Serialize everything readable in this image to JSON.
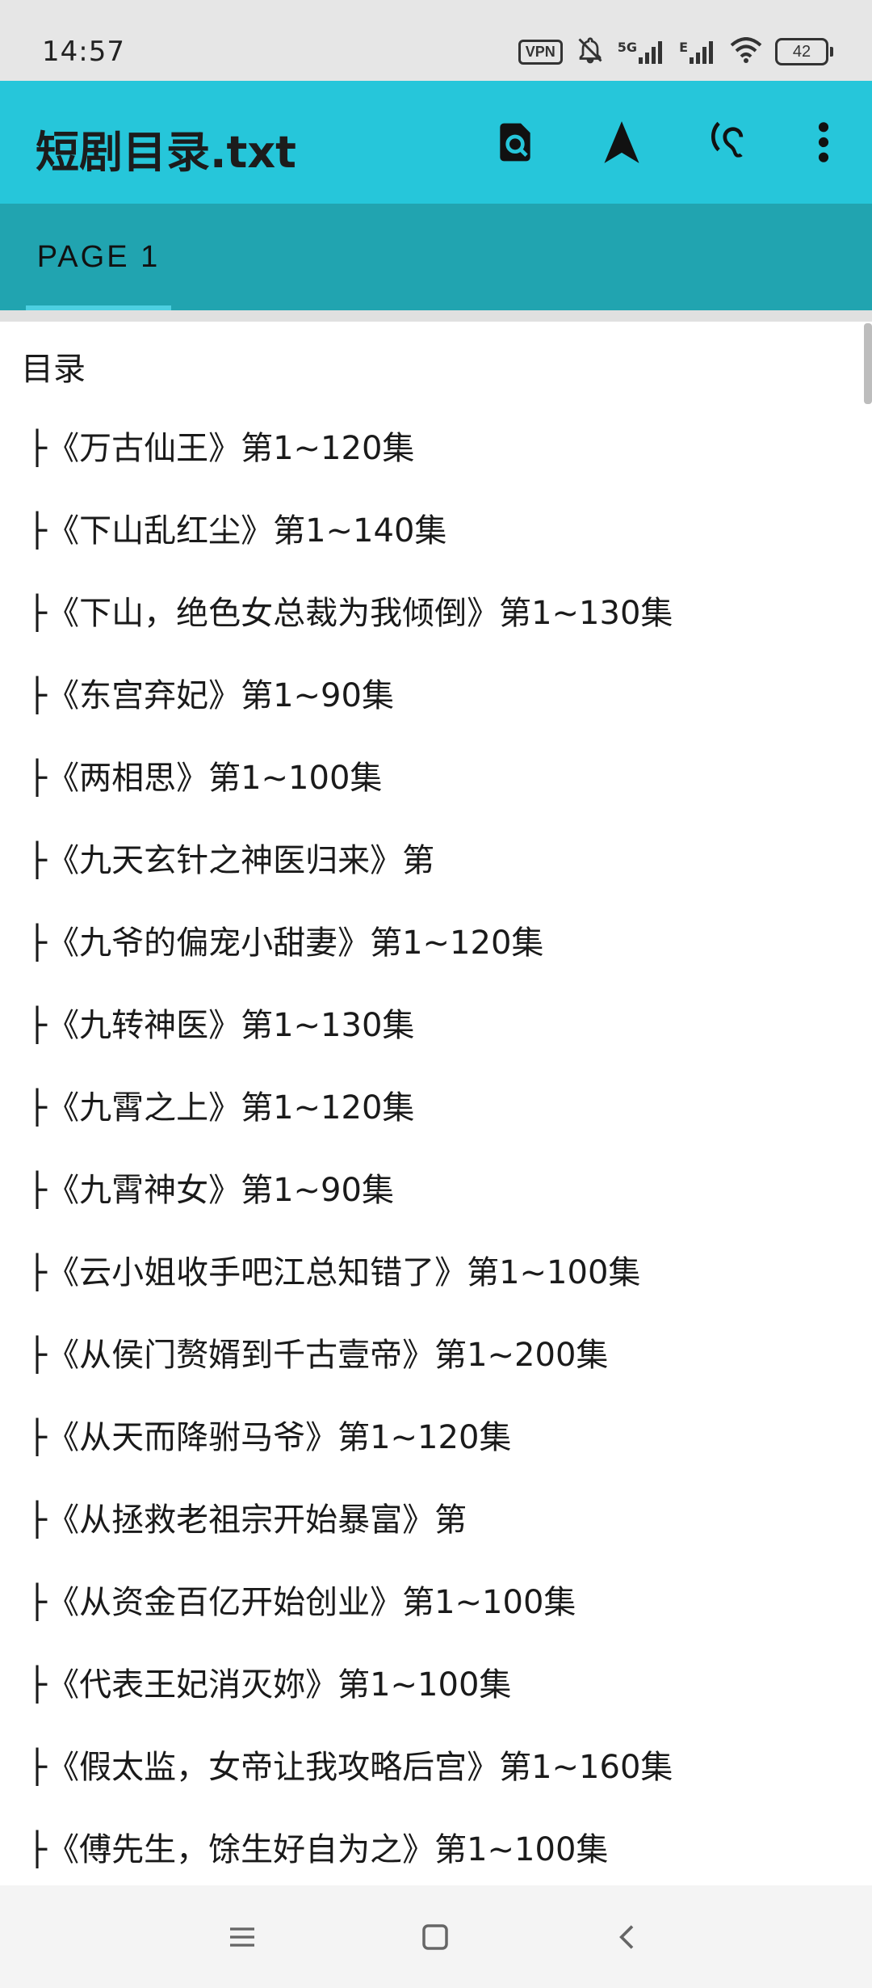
{
  "status_bar": {
    "time": "14:57",
    "vpn_label": "VPN",
    "network_5g": "5G",
    "network_e": "E",
    "battery_level": "42",
    "icons": [
      "vpn-icon",
      "bell-off-icon",
      "signal-5g-icon",
      "signal-e-icon",
      "wifi-icon",
      "battery-icon"
    ]
  },
  "app_bar": {
    "title": "短剧目录.txt",
    "background_color": "#26c6da",
    "icons": [
      "search-document-icon",
      "navigation-arrow-icon",
      "hearing-icon",
      "more-vert-icon"
    ]
  },
  "tabs": {
    "active_label": "PAGE 1",
    "background_color": "#21a4b0"
  },
  "document": {
    "heading": "目录",
    "lines": [
      "├《万古仙王》第1~120集",
      "├《下山乱红尘》第1~140集",
      "├《下山，绝色女总裁为我倾倒》第1~130集",
      "├《东宫弃妃》第1~90集",
      "├《两相思》第1~100集",
      "├《九天玄针之神医归来》第",
      "├《九爷的偏宠小甜妻》第1~120集",
      "├《九转神医》第1~130集",
      "├《九霄之上》第1~120集",
      "├《九霄神女》第1~90集",
      "├《云小姐收手吧江总知错了》第1~100集",
      "├《从侯门赘婿到千古壹帝》第1~200集",
      "├《从天而降驸马爷》第1~120集",
      "├《从拯救老祖宗开始暴富》第",
      "├《从资金百亿开始创业》第1~100集",
      "├《代表王妃消灭妳》第1~100集",
      "├《假太监，女帝让我攻略后宫》第1~160集",
      "├《傅先生，馀生好自为之》第1~100集"
    ]
  },
  "nav_bar": {
    "icons": [
      "menu-icon",
      "home-square-icon",
      "back-chevron-icon"
    ]
  }
}
